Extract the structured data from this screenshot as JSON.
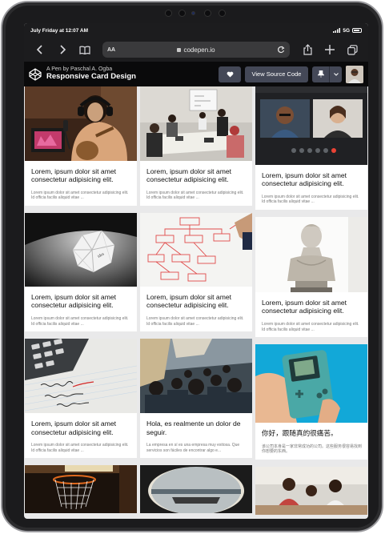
{
  "status_bar": {
    "time": "July Friday at 12:07 AM",
    "signal": "5G"
  },
  "browser": {
    "text_size_label": "AA",
    "url": "codepen.io",
    "back_icon": "chevron-left-icon",
    "forward_icon": "chevron-right-icon",
    "bookmarks_icon": "book-icon",
    "reload_icon": "reload-icon",
    "share_icon": "share-icon",
    "new_tab_icon": "plus-icon",
    "tabs_icon": "tabs-icon"
  },
  "codepen": {
    "byline": "A Pen by Paschal A. Ogba",
    "title": "Responsive Card Design",
    "heart_icon": "heart-icon",
    "view_source_label": "View Source Code",
    "pin_icon": "pin-icon",
    "dropdown_icon": "chevron-down-icon"
  },
  "colors": {
    "page_bg": "#e9e9ea",
    "header_bg": "#0a0a0b",
    "button_bg": "#444857",
    "card_bg": "#ffffff"
  },
  "cards": {
    "c1": {
      "title": "Lorem, ipsum dolor sit amet consectetur adipisicing elit.",
      "text": "Lorem ipsum dolor sit amet consectetur adipisicing elit. Id officia facilis aliquid vitae ..."
    },
    "c2": {
      "title": "Lorem, ipsum dolor sit amet consectetur adipisicing elit.",
      "text": "Lorem ipsum dolor sit amet consectetur adipisicing elit. Id officia facilis aliquid vitae ..."
    },
    "c3": {
      "title": "Lorem, ipsum dolor sit amet consectetur adipisicing elit.",
      "text": "Lorem ipsum dolor sit amet consectetur adipisicing elit. Id officia facilis aliquid vitae ..."
    },
    "c4": {
      "title": "Lorem, ipsum dolor sit amet consectetur adipisicing elit.",
      "text": "Lorem ipsum dolor sit amet consectetur adipisicing elit. Id officia facilis aliquid vitae ..."
    },
    "c5": {
      "title": "Lorem, ipsum dolor sit amet consectetur adipisicing elit.",
      "text": "Lorem ipsum dolor sit amet consectetur adipisicing elit. Id officia facilis aliquid vitae ..."
    },
    "c6": {
      "title": "Lorem, ipsum dolor sit amet consectetur adipisicing elit.",
      "text": "Lorem ipsum dolor sit amet consectetur adipisicing elit. Id officia facilis aliquid vitae ..."
    },
    "c7": {
      "title": "Lorem, ipsum dolor sit amet consectetur adipisicing elit.",
      "text": "Lorem ipsum dolor sit amet consectetur adipisicing elit. Id officia facilis aliquid vitae ..."
    },
    "c8": {
      "title": "Hola, es realmente un dolor de seguir.",
      "text": "La empresa en sí es una empresa muy exitosa. Que servicios son fáciles de encontrar algo e..."
    },
    "c9": {
      "title": "你好，跟随真的很痛苦。",
      "text": "该公司本身是一家非常成功的公司。这些服务很容易找到你想要的东西。"
    }
  }
}
